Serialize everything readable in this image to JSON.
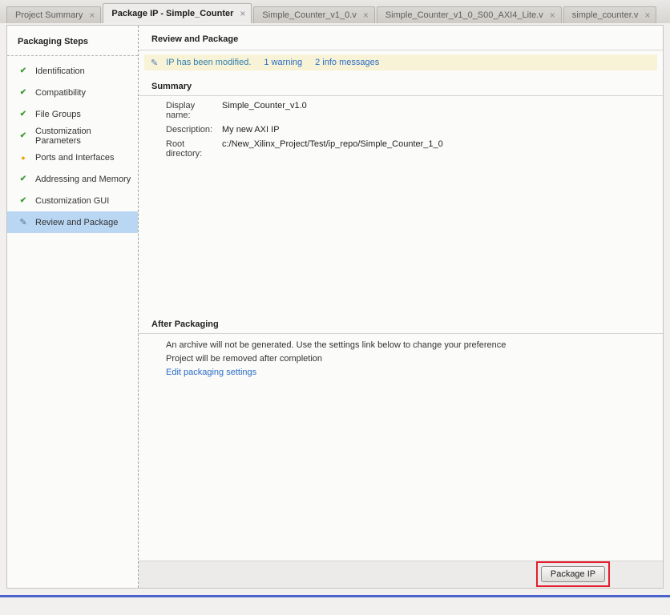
{
  "tabs": [
    {
      "label": "Project Summary",
      "active": false
    },
    {
      "label": "Package IP - Simple_Counter",
      "active": true
    },
    {
      "label": "Simple_Counter_v1_0.v",
      "active": false
    },
    {
      "label": "Simple_Counter_v1_0_S00_AXI4_Lite.v",
      "active": false
    },
    {
      "label": "simple_counter.v",
      "active": false
    }
  ],
  "icons": {
    "close": "×",
    "check": "✔",
    "warning": "●",
    "edit": "✎",
    "pencil": "✎"
  },
  "sidebar": {
    "title": "Packaging Steps",
    "items": [
      {
        "label": "Identification",
        "status": "done"
      },
      {
        "label": "Compatibility",
        "status": "done"
      },
      {
        "label": "File Groups",
        "status": "done"
      },
      {
        "label": "Customization Parameters",
        "status": "done"
      },
      {
        "label": "Ports and Interfaces",
        "status": "warning"
      },
      {
        "label": "Addressing and Memory",
        "status": "done"
      },
      {
        "label": "Customization GUI",
        "status": "done"
      },
      {
        "label": "Review and Package",
        "status": "editing",
        "selected": true
      }
    ]
  },
  "main": {
    "title": "Review and Package",
    "notification": {
      "message": "IP has been modified.",
      "warning_link": "1 warning",
      "info_link": "2 info messages"
    },
    "summary": {
      "title": "Summary",
      "fields": [
        {
          "label": "Display name:",
          "value": "Simple_Counter_v1.0"
        },
        {
          "label": "Description:",
          "value": "My new AXI IP"
        },
        {
          "label": "Root directory:",
          "value": "c:/New_Xilinx_Project/Test/ip_repo/Simple_Counter_1_0"
        }
      ]
    },
    "after_packaging": {
      "title": "After Packaging",
      "lines": [
        "An archive will not be generated. Use the settings link below to change your preference",
        "Project will be removed after completion"
      ],
      "link": "Edit packaging settings"
    },
    "package_button": "Package IP"
  },
  "colors": {
    "selected_step_bg": "#b9d6f2",
    "notification_bg": "#f8f3d6",
    "link_blue": "#2a6cc4",
    "check_green": "#3f9c35",
    "warning_yellow": "#f0a800",
    "highlight_red": "#e41e2d",
    "bottom_accent_blue": "#4a63c8"
  }
}
